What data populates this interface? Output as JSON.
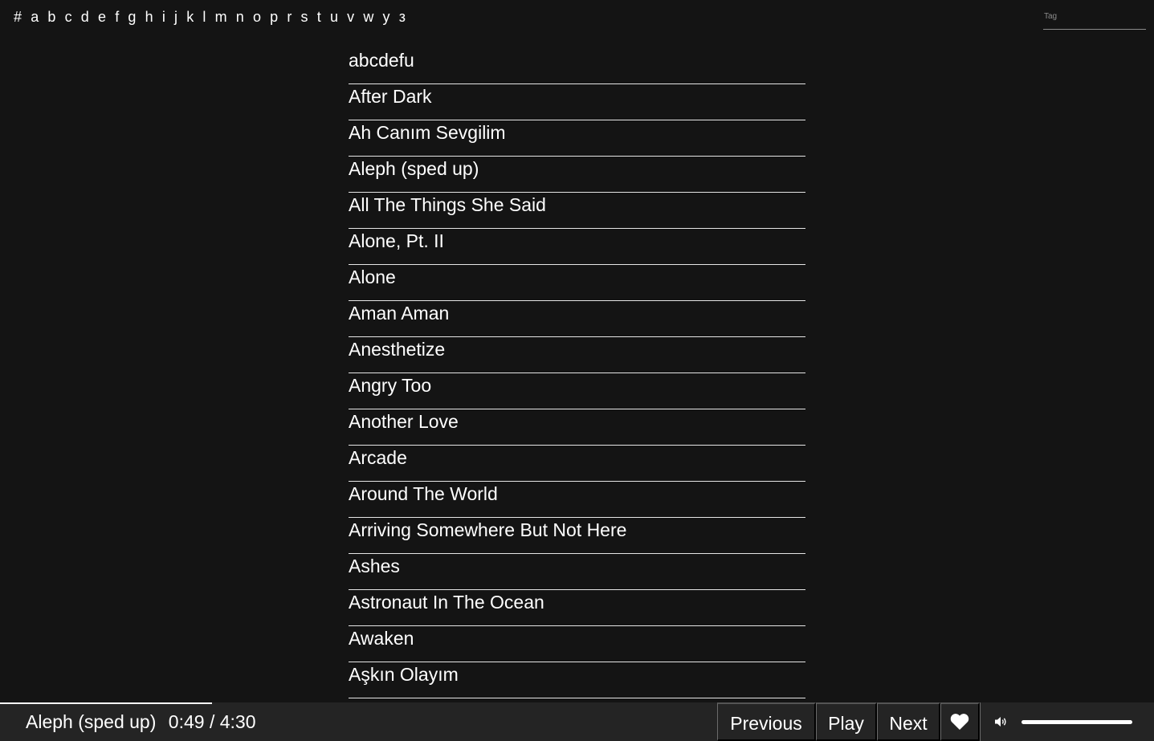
{
  "alphabet": [
    "#",
    "a",
    "b",
    "c",
    "d",
    "e",
    "f",
    "g",
    "h",
    "i",
    "j",
    "k",
    "l",
    "m",
    "n",
    "o",
    "p",
    "r",
    "s",
    "t",
    "u",
    "v",
    "w",
    "y",
    "з"
  ],
  "search": {
    "placeholder": "Tag",
    "value": ""
  },
  "songs": [
    "abcdefu",
    "After Dark",
    "Ah Canım Sevgilim",
    "Aleph (sped up)",
    "All The Things She Said",
    "Alone, Pt. II",
    "Alone",
    "Aman Aman",
    "Anesthetize",
    "Angry Too",
    "Another Love",
    "Arcade",
    "Around The World",
    "Arriving Somewhere But Not Here",
    "Ashes",
    "Astronaut In The Ocean",
    "Awaken",
    "Aşkın Olayım"
  ],
  "player": {
    "track_title": "Aleph (sped up)",
    "current_time": "0:49",
    "separator": "/",
    "duration": "4:30",
    "progress_fraction": 0.184,
    "volume_fraction": 1.0,
    "previous_label": "Previous",
    "play_label": "Play",
    "next_label": "Next",
    "like_icon": "heart-icon",
    "volume_icon": "speaker-icon"
  },
  "colors": {
    "background": "#141414",
    "player_background": "#242424",
    "text": "#ffffff",
    "divider": "#6b6b6b"
  }
}
